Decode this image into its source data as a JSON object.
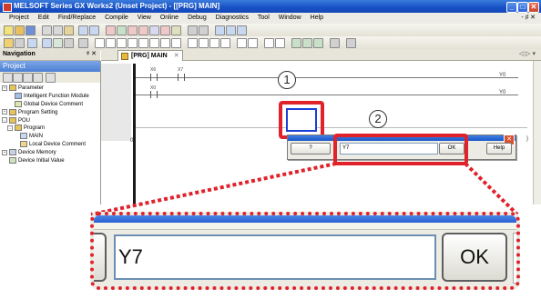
{
  "window": {
    "title": "MELSOFT Series GX Works2 (Unset Project) - [[PRG] MAIN]",
    "minimize": "_",
    "restore": "□",
    "close": "✕"
  },
  "menu": {
    "items": [
      "Project",
      "Edit",
      "Find/Replace",
      "Compile",
      "View",
      "Online",
      "Debug",
      "Diagnostics",
      "Tool",
      "Window",
      "Help"
    ],
    "mdi_controls": "- ♯ ✕"
  },
  "navigation": {
    "header": "Navigation",
    "pin": "ᵠ ✕",
    "panel_title": "Project",
    "tree": [
      {
        "label": "Parameter",
        "indent": 0,
        "expander": "+"
      },
      {
        "label": "Intelligent Function Module",
        "indent": 1,
        "expander": ""
      },
      {
        "label": "Global Device Comment",
        "indent": 1,
        "expander": ""
      },
      {
        "label": "Program Setting",
        "indent": 0,
        "expander": "+"
      },
      {
        "label": "POU",
        "indent": 0,
        "expander": "-"
      },
      {
        "label": "Program",
        "indent": 1,
        "expander": "-"
      },
      {
        "label": "MAIN",
        "indent": 2,
        "expander": ""
      },
      {
        "label": "Local Device Comment",
        "indent": 2,
        "expander": ""
      },
      {
        "label": "Device Memory",
        "indent": 0,
        "expander": "+"
      },
      {
        "label": "Device Initial Value",
        "indent": 0,
        "expander": ""
      }
    ]
  },
  "editor": {
    "tab_label": "[PRG] MAIN",
    "tab_close": "✕",
    "nav_arrows": "◁ ▷ ▾",
    "contacts": [
      {
        "label": "X6"
      },
      {
        "label": "X7"
      },
      {
        "label": "X0"
      }
    ],
    "coils": [
      "Y0",
      "Y0"
    ],
    "step_number": "0",
    "right_brace": "}"
  },
  "dialog": {
    "input_value": "Y7",
    "ok_label": "OK",
    "help_label": "Help",
    "left_label": "?"
  },
  "callouts": {
    "step1": "1",
    "step2": "2"
  },
  "zoom": {
    "input_value": "Y7",
    "ok_label": "OK"
  },
  "colors": {
    "callout_red": "#e0222b",
    "titlebar_blue": "#1750c6",
    "cursor_blue": "#1a3fd6"
  }
}
